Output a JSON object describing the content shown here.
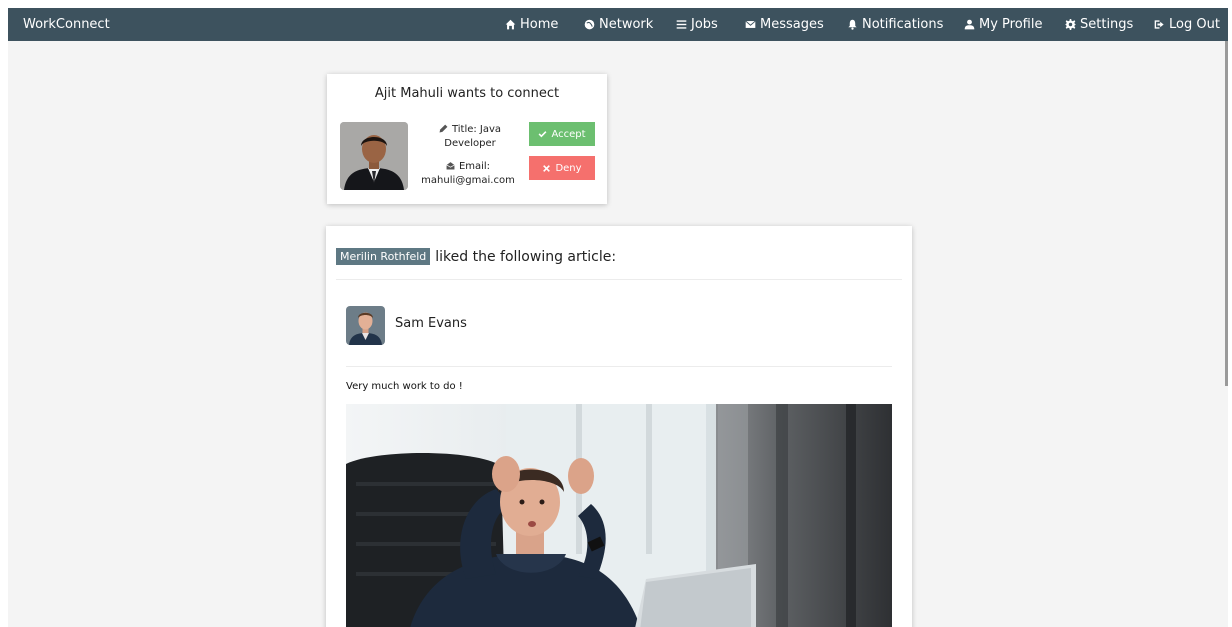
{
  "navbar": {
    "brand": "WorkConnect",
    "items": [
      {
        "label": "Home",
        "icon": "home-icon"
      },
      {
        "label": "Network",
        "icon": "globe-icon"
      },
      {
        "label": "Jobs",
        "icon": "list-icon"
      },
      {
        "label": "Messages",
        "icon": "envelope-icon"
      },
      {
        "label": "Notifications",
        "icon": "bell-icon"
      },
      {
        "label": "My Profile",
        "icon": "user-icon"
      },
      {
        "label": "Settings",
        "icon": "gear-icon"
      },
      {
        "label": "Log Out",
        "icon": "logout-icon"
      }
    ]
  },
  "connect_request": {
    "title": "Ajit Mahuli wants to connect",
    "title_line": "Title: Java Developer",
    "email_line": "Email: mahuli@gmai.com",
    "accept_label": "Accept",
    "deny_label": "Deny"
  },
  "activity": {
    "liker": "Merilin Rothfeld",
    "text": "liked the following article:",
    "post": {
      "author": "Sam Evans",
      "text": "Very much work to do !"
    }
  },
  "colors": {
    "navbar": "#3d525e",
    "accept": "#6cbf70",
    "deny": "#f5706d",
    "badge": "#5e7883",
    "page_bg": "#f4f4f4"
  }
}
